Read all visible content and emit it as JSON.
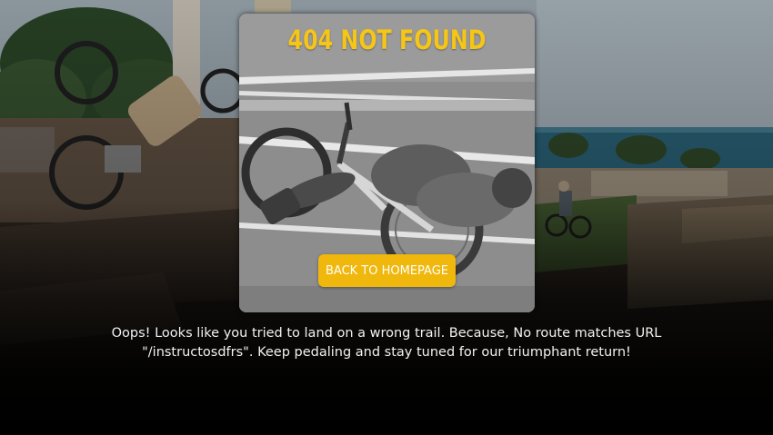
{
  "error": {
    "title": "404 NOT FOUND",
    "button_label": "BACK TO HOMEPAGE",
    "message": "Oops! Looks like you tried to land on a wrong trail. Because, No route matches URL \"/instructosdfrs\". Keep pedaling and stay tuned for our triumphant return!"
  },
  "colors": {
    "title": "#f5c518",
    "button_background": "#f0b70c",
    "button_text": "#ffffff",
    "message_text": "#f2f2f2",
    "page_background": "#000000"
  }
}
